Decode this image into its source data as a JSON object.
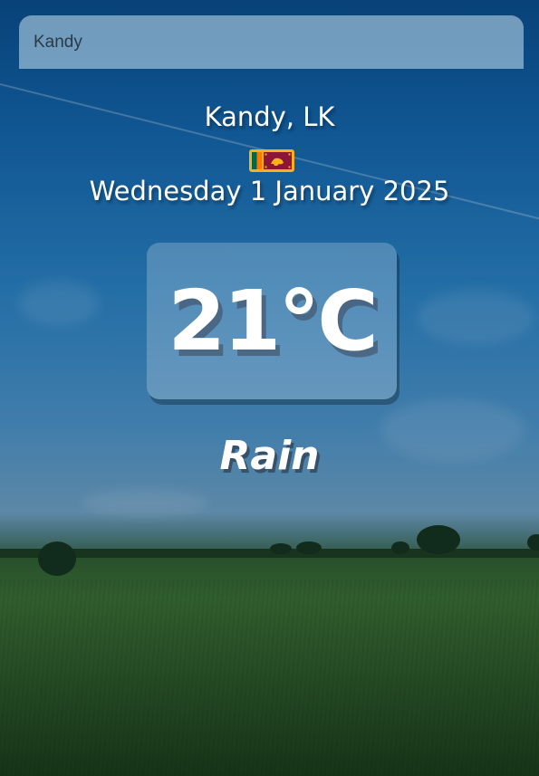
{
  "search": {
    "value": "Kandy"
  },
  "location": {
    "label": "Kandy, LK"
  },
  "date": {
    "label": "Wednesday 1 January 2025"
  },
  "temperature": {
    "value": "21°C"
  },
  "condition": {
    "label": "Rain"
  },
  "flag": {
    "icon": "sri-lanka-flag-icon"
  }
}
